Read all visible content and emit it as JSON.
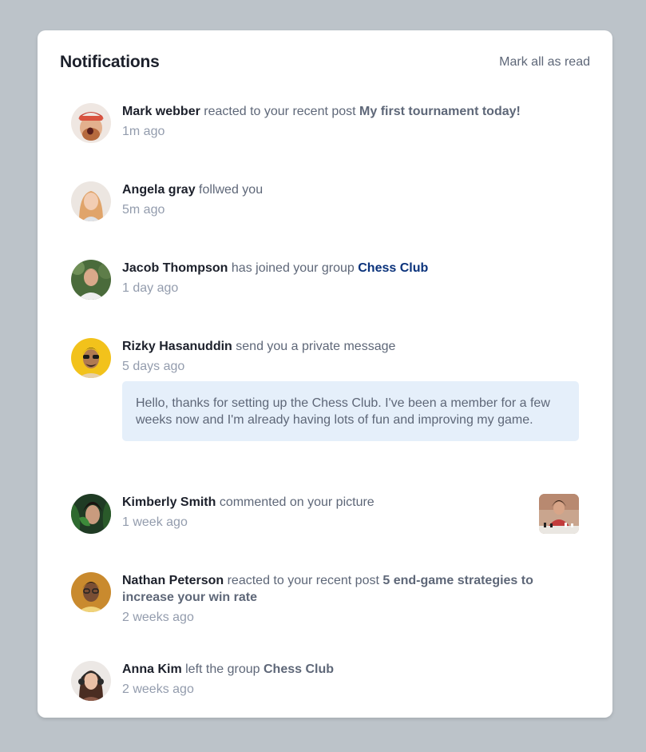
{
  "header": {
    "title": "Notifications",
    "mark_all_label": "Mark all as read"
  },
  "notifications": [
    {
      "name": "Mark webber",
      "action": "reacted to your recent post",
      "target": "My first tournament today!",
      "time": "1m ago"
    },
    {
      "name": "Angela gray",
      "action": "follwed you",
      "time": "5m ago"
    },
    {
      "name": "Jacob Thompson",
      "action": "has joined your group",
      "target": "Chess Club",
      "time": "1 day ago"
    },
    {
      "name": "Rizky Hasanuddin",
      "action": "send you a private message",
      "time": "5 days ago",
      "message": "Hello, thanks for setting up the Chess Club. I've been a member for a few weeks now and I'm already having lots of fun and improving my game."
    },
    {
      "name": "Kimberly Smith",
      "action": "commented on your picture",
      "time": "1 week ago"
    },
    {
      "name": "Nathan Peterson",
      "action": "reacted to your recent post",
      "target": "5 end-game strategies to increase your win rate",
      "time": "2 weeks ago"
    },
    {
      "name": "Anna Kim",
      "action": "left the group",
      "target": "Chess Club",
      "time": "2 weeks ago"
    }
  ],
  "colors": {
    "background": "#bcc3c9",
    "card": "#ffffff",
    "heading": "#1c202b",
    "text": "#5e6778",
    "muted": "#939cad",
    "group_link": "#0a327b",
    "message_bg": "#e5effa"
  }
}
